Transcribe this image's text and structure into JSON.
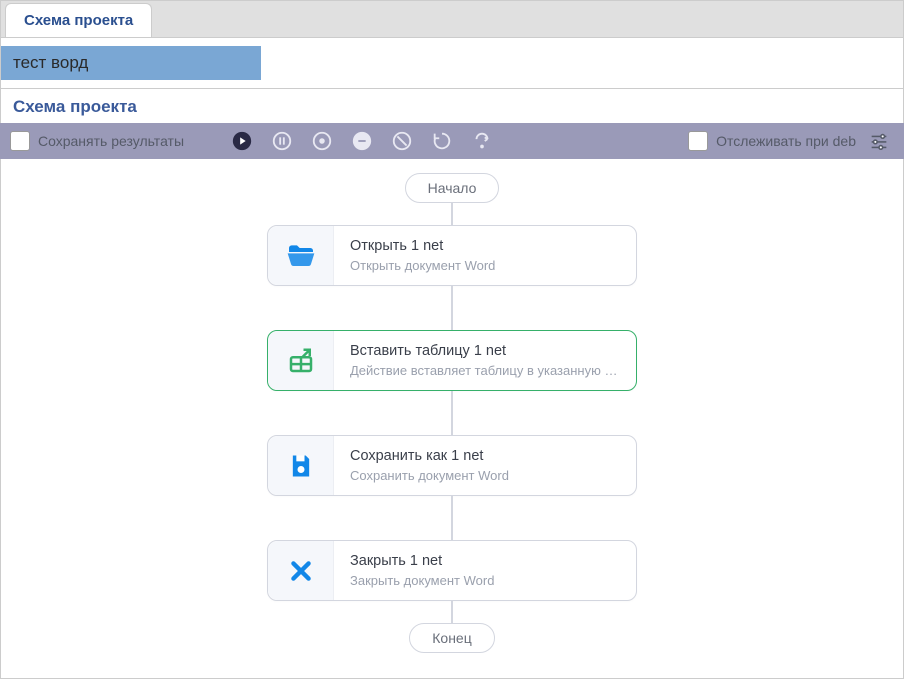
{
  "tab": {
    "label": "Схема проекта"
  },
  "project_name": "тест ворд",
  "section_title": "Схема проекта",
  "toolbar": {
    "save_results_label": "Сохранять результаты",
    "track_debug_label": "Отслеживать при deb"
  },
  "flow": {
    "start_label": "Начало",
    "end_label": "Конец",
    "steps": [
      {
        "title": "Открыть  1  net",
        "subtitle": "Открыть документ Word",
        "icon": "folder-open-icon",
        "selected": false
      },
      {
        "title": "Вставить таблицу  1  net",
        "subtitle": "Действие вставляет таблицу в указанную обл...",
        "icon": "insert-table-icon",
        "selected": true
      },
      {
        "title": "Сохранить как  1  net",
        "subtitle": "Сохранить документ Word",
        "icon": "save-icon",
        "selected": false
      },
      {
        "title": "Закрыть  1  net",
        "subtitle": "Закрыть документ Word",
        "icon": "close-icon",
        "selected": false
      }
    ]
  }
}
